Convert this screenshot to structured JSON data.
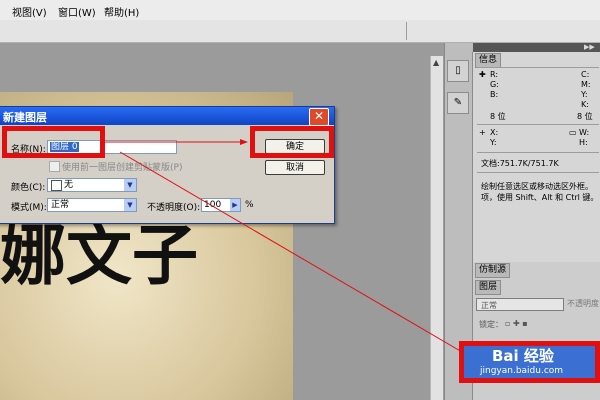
{
  "menu": {
    "items": [
      "视图(V)",
      "窗口(W)",
      "帮助(H)"
    ]
  },
  "info_panel": {
    "tab": "信息",
    "rgb": [
      "R:",
      "G:",
      "B:"
    ],
    "cmyk": [
      "C:",
      "M:",
      "Y:",
      "K:"
    ],
    "bit_left": "8 位",
    "bit_right": "8 位",
    "xy": [
      "X:",
      "Y:"
    ],
    "wh": [
      "W:",
      "H:"
    ],
    "doc": "文档:751.7K/751.7K",
    "hint_line1": "绘制任意选区或移动选区外框。",
    "hint_line2": "项，使用 Shift、Alt 和 Ctrl 键。"
  },
  "mid_panel": {
    "tab": "仿制源"
  },
  "layers_panel": {
    "tab": "图层",
    "blend_mode": "正常",
    "opacity_label": "不透明度",
    "lock_label": "锁定："
  },
  "dialog": {
    "title": "新建图层",
    "name_label": "名称(N):",
    "name_value": "图层 0",
    "clip_label": "使用前一图层创建剪贴蒙版(P)",
    "color_label": "颜色(C):",
    "color_value": "无",
    "mode_label": "模式(M):",
    "mode_value": "正常",
    "opacity_label": "不透明度(O):",
    "opacity_value": "100",
    "opacity_unit": "%",
    "ok_label": "确定",
    "cancel_label": "取消",
    "close_label": "✕"
  },
  "canvas_art": {
    "glyphs": "娜文子"
  },
  "watermark": {
    "brand": "Bai 经验",
    "url": "jingyan.baidu.com"
  },
  "colors": {
    "annotation": "#e01010",
    "titlebar": "#0f44c4",
    "selection": "#316ac5"
  }
}
